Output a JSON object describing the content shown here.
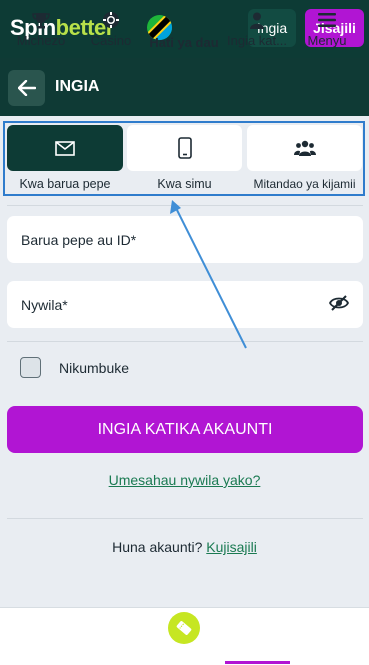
{
  "header": {
    "logo_spin": "Spin",
    "logo_better": "better",
    "login_label": "Ingia",
    "register_label": "Jisajili"
  },
  "subheader": {
    "title": "INGIA",
    "back_icon": "arrow-left-icon"
  },
  "tabs": [
    {
      "label": "Kwa barua pepe",
      "icon": "envelope-icon",
      "active": true
    },
    {
      "label": "Kwa simu",
      "icon": "smartphone-icon",
      "active": false
    },
    {
      "label": "Mitandao ya kijamii",
      "icon": "users-icon",
      "active": false
    }
  ],
  "form": {
    "email_placeholder": "Barua pepe au ID*",
    "password_placeholder": "Nywila*",
    "remember_label": "Nikumbuke",
    "submit_label": "INGIA KATIKA AKAUNTI",
    "forgot_link": "Umesahau nywila yako?",
    "no_account_text": "Huna akaunti?",
    "register_link": "Kujisajili"
  },
  "bottom_nav": [
    {
      "label": "Michezo",
      "icon": "trophy-icon"
    },
    {
      "label": "Casino",
      "icon": "casino-chip-icon"
    },
    {
      "label": "Hati ya dau",
      "icon": "ticket-icon"
    },
    {
      "label": "Ingia kat...",
      "icon": "user-icon"
    },
    {
      "label": "Menyu",
      "icon": "hamburger-icon"
    }
  ],
  "colors": {
    "header_bg": "#0d3b35",
    "accent_purple": "#b115d3",
    "logo_green": "#b8e04a",
    "link_green": "#1a7a52",
    "annotation_blue": "#2f7ccc"
  }
}
